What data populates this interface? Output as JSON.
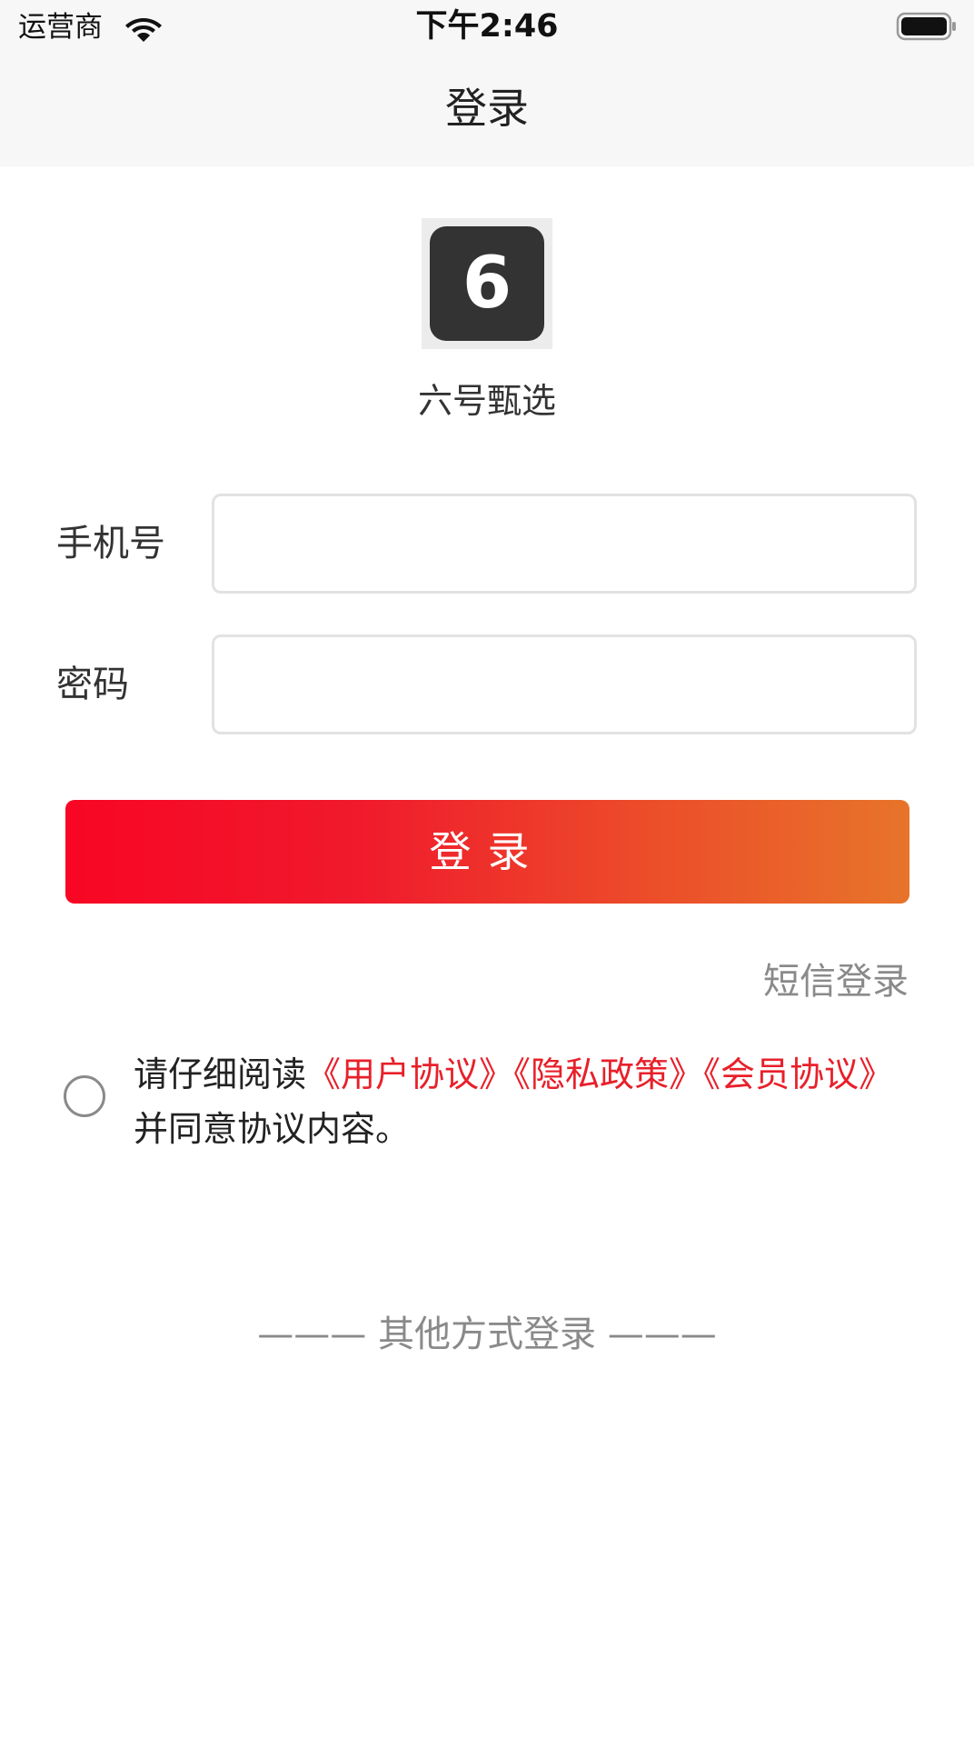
{
  "status_bar": {
    "carrier": "运营商",
    "time": "下午2:46",
    "wifi_icon": "wifi-icon",
    "battery_icon": "battery-icon"
  },
  "nav": {
    "title": "登录"
  },
  "app": {
    "logo_text": "6",
    "name": "六号甄选"
  },
  "form": {
    "phone_label": "手机号",
    "phone_value": "",
    "phone_placeholder": "",
    "password_label": "密码",
    "password_value": "",
    "password_placeholder": ""
  },
  "actions": {
    "login_label": "登录",
    "sms_login_label": "短信登录"
  },
  "agreement": {
    "checked": false,
    "prefix": "请仔细阅读",
    "user_agreement": "《用户协议》",
    "privacy_policy": "《隐私政策》",
    "member_agreement": "《会员协议》",
    "suffix": "并同意协议内容。"
  },
  "other_login": {
    "label": "——— 其他方式登录 ———"
  },
  "colors": {
    "accent": "#e8202a",
    "button_start": "#f80624",
    "button_end": "#e7742a",
    "muted_text": "#8a8a8a",
    "nav_background": "#f7f7f7"
  }
}
